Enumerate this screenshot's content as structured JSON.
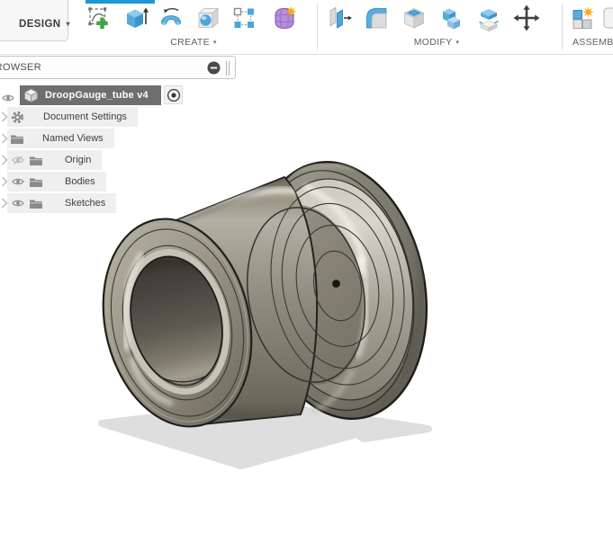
{
  "workspace": {
    "label": "DESIGN",
    "caret": "▾"
  },
  "toolbar": {
    "groups": [
      {
        "label": "CREATE",
        "caret": "▾",
        "tools": [
          "create-sketch",
          "extrude",
          "revolve",
          "hole",
          "rectangular-pattern",
          "create-form"
        ]
      },
      {
        "label": "MODIFY",
        "caret": "▾",
        "tools": [
          "press-pull",
          "fillet",
          "shell",
          "combine",
          "split-body",
          "move-copy"
        ]
      },
      {
        "label": "ASSEMBLE",
        "caret": "▾",
        "tools": [
          "new-component"
        ]
      }
    ]
  },
  "browser": {
    "title": "BROWSER",
    "component": {
      "label": "DroopGauge_tube v4",
      "selected": true
    },
    "rows": [
      {
        "label": "Document Settings",
        "icon": "gear-icon"
      },
      {
        "label": "Named Views",
        "icon": "folder-icon"
      },
      {
        "label": "Origin",
        "icon": "folder-icon",
        "visibility": "hidden"
      },
      {
        "label": "Bodies",
        "icon": "folder-icon",
        "visibility": "visible"
      },
      {
        "label": "Sketches",
        "icon": "folder-icon",
        "visibility": "visible"
      }
    ]
  },
  "colors": {
    "accent_blue": "#1e97d4",
    "selection_gray": "#6e6e6e",
    "model_base": "#8e8b7f",
    "shadow": "#dedede",
    "canvas": "#ffffff"
  }
}
